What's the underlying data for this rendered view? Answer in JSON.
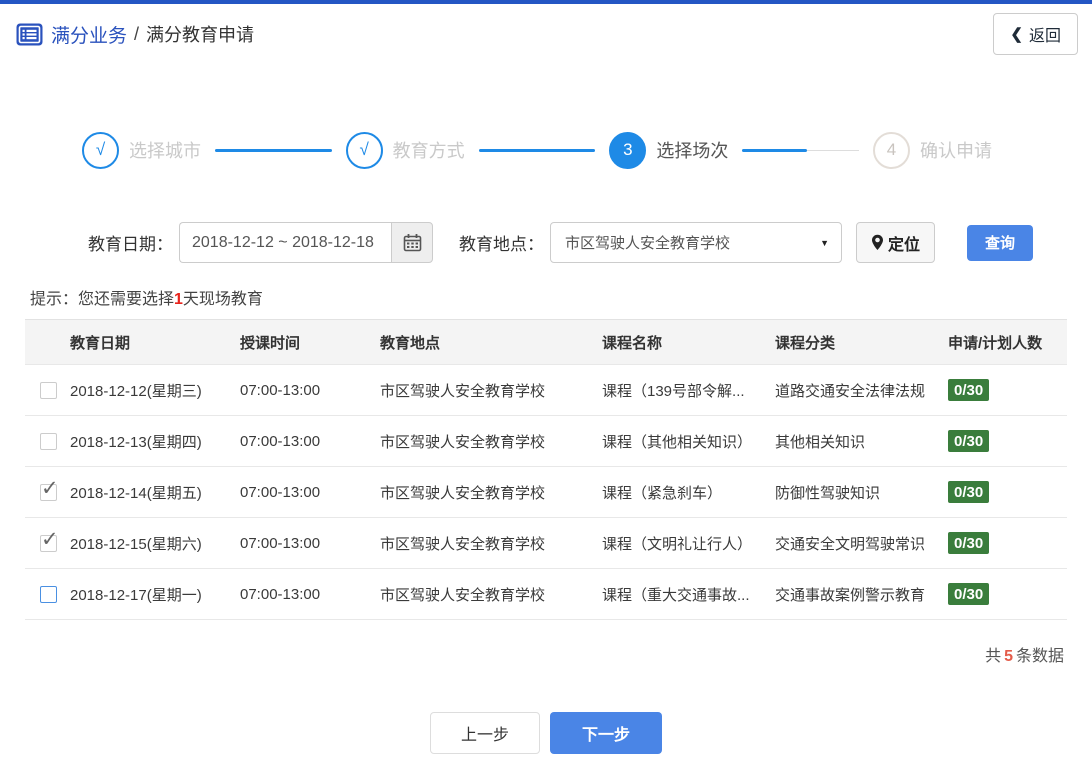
{
  "header": {
    "section": "满分业务",
    "separator": "/",
    "page": "满分教育申请",
    "back_icon": "❮",
    "back_label": "返回"
  },
  "steps": [
    {
      "marker": "√",
      "label": "选择城市",
      "state": "done"
    },
    {
      "marker": "√",
      "label": "教育方式",
      "state": "done"
    },
    {
      "marker": "3",
      "label": "选择场次",
      "state": "active"
    },
    {
      "marker": "4",
      "label": "确认申请",
      "state": "pending"
    }
  ],
  "filters": {
    "date_label": "教育日期：",
    "date_value": "2018-12-12 ~ 2018-12-18",
    "location_label": "教育地点：",
    "location_value": "市区驾驶人安全教育学校",
    "caret": "▼",
    "locate_label": "定位",
    "search_label": "查询"
  },
  "hint": {
    "prefix": "提示：您还需要选择",
    "highlight": "1",
    "suffix": "天现场教育"
  },
  "table": {
    "columns": [
      "教育日期",
      "授课时间",
      "教育地点",
      "课程名称",
      "课程分类",
      "申请/计划人数"
    ],
    "check_mark": "✓",
    "rows": [
      {
        "checked": false,
        "focused": false,
        "date": "2018-12-12(星期三)",
        "time": "07:00-13:00",
        "location": "市区驾驶人安全教育学校",
        "course": "课程（139号部令解...",
        "category": "道路交通安全法律法规",
        "count": "0/30"
      },
      {
        "checked": false,
        "focused": false,
        "date": "2018-12-13(星期四)",
        "time": "07:00-13:00",
        "location": "市区驾驶人安全教育学校",
        "course": "课程（其他相关知识）",
        "category": "其他相关知识",
        "count": "0/30"
      },
      {
        "checked": true,
        "focused": false,
        "date": "2018-12-14(星期五)",
        "time": "07:00-13:00",
        "location": "市区驾驶人安全教育学校",
        "course": "课程（紧急刹车）",
        "category": "防御性驾驶知识",
        "count": "0/30"
      },
      {
        "checked": true,
        "focused": false,
        "date": "2018-12-15(星期六)",
        "time": "07:00-13:00",
        "location": "市区驾驶人安全教育学校",
        "course": "课程（文明礼让行人）",
        "category": "交通安全文明驾驶常识",
        "count": "0/30"
      },
      {
        "checked": false,
        "focused": true,
        "date": "2018-12-17(星期一)",
        "time": "07:00-13:00",
        "location": "市区驾驶人安全教育学校",
        "course": "课程（重大交通事故...",
        "category": "交通事故案例警示教育",
        "count": "0/30"
      }
    ],
    "summary": {
      "prefix": "共",
      "count": "5",
      "suffix": "条数据"
    }
  },
  "footer": {
    "prev_label": "上一步",
    "next_label": "下一步"
  },
  "colors": {
    "topbar_blue": "#2456c4",
    "brand_blue": "#2a52bd",
    "step_blue": "#1e8ae6",
    "button_blue": "#4a85e6",
    "badge_green": "#3a7d3c",
    "hint_red": "#e8241c",
    "summary_red": "#e45c4a"
  }
}
